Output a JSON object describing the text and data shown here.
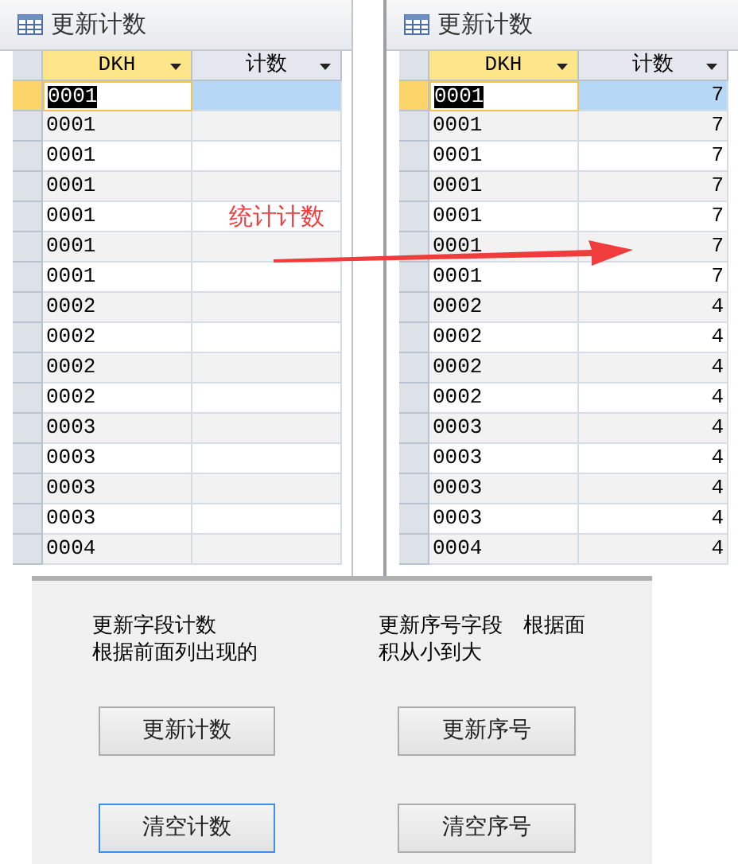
{
  "windows": [
    {
      "title": "更新计数",
      "columns": [
        {
          "label": "DKH"
        },
        {
          "label": "计数"
        }
      ],
      "rows": [
        {
          "dkh": "0001",
          "selected": true
        },
        {
          "dkh": "0001",
          "selected": false
        },
        {
          "dkh": "0001",
          "selected": false
        },
        {
          "dkh": "0001",
          "selected": false
        },
        {
          "dkh": "0001",
          "selected": false
        },
        {
          "dkh": "0001",
          "selected": false
        },
        {
          "dkh": "0001",
          "selected": false
        },
        {
          "dkh": "0002",
          "selected": false
        },
        {
          "dkh": "0002",
          "selected": false
        },
        {
          "dkh": "0002",
          "selected": false
        },
        {
          "dkh": "0002",
          "selected": false
        },
        {
          "dkh": "0003",
          "selected": false
        },
        {
          "dkh": "0003",
          "selected": false
        },
        {
          "dkh": "0003",
          "selected": false
        },
        {
          "dkh": "0003",
          "selected": false
        },
        {
          "dkh": "0004",
          "selected": false
        }
      ]
    },
    {
      "title": "更新计数",
      "columns": [
        {
          "label": "DKH"
        },
        {
          "label": "计数"
        }
      ],
      "rows": [
        {
          "dkh": "0001",
          "count": "7",
          "selected": true
        },
        {
          "dkh": "0001",
          "count": "7",
          "selected": false
        },
        {
          "dkh": "0001",
          "count": "7",
          "selected": false
        },
        {
          "dkh": "0001",
          "count": "7",
          "selected": false
        },
        {
          "dkh": "0001",
          "count": "7",
          "selected": false
        },
        {
          "dkh": "0001",
          "count": "7",
          "selected": false
        },
        {
          "dkh": "0001",
          "count": "7",
          "selected": false
        },
        {
          "dkh": "0002",
          "count": "4",
          "selected": false
        },
        {
          "dkh": "0002",
          "count": "4",
          "selected": false
        },
        {
          "dkh": "0002",
          "count": "4",
          "selected": false
        },
        {
          "dkh": "0002",
          "count": "4",
          "selected": false
        },
        {
          "dkh": "0003",
          "count": "4",
          "selected": false
        },
        {
          "dkh": "0003",
          "count": "4",
          "selected": false
        },
        {
          "dkh": "0003",
          "count": "4",
          "selected": false
        },
        {
          "dkh": "0003",
          "count": "4",
          "selected": false
        },
        {
          "dkh": "0004",
          "count": "4",
          "selected": false
        }
      ]
    }
  ],
  "annotation": {
    "text": "统计计数"
  },
  "panel": {
    "notes": [
      {
        "lines": [
          "更新字段计数",
          "根据前面列出现的"
        ]
      },
      {
        "lines": [
          "更新序号字段　根据面",
          "积从小到大"
        ]
      }
    ],
    "buttons": [
      {
        "label": "更新计数",
        "focused": false
      },
      {
        "label": "更新序号",
        "focused": false
      },
      {
        "label": "清空计数",
        "focused": true
      },
      {
        "label": "清空序号",
        "focused": false
      }
    ]
  }
}
